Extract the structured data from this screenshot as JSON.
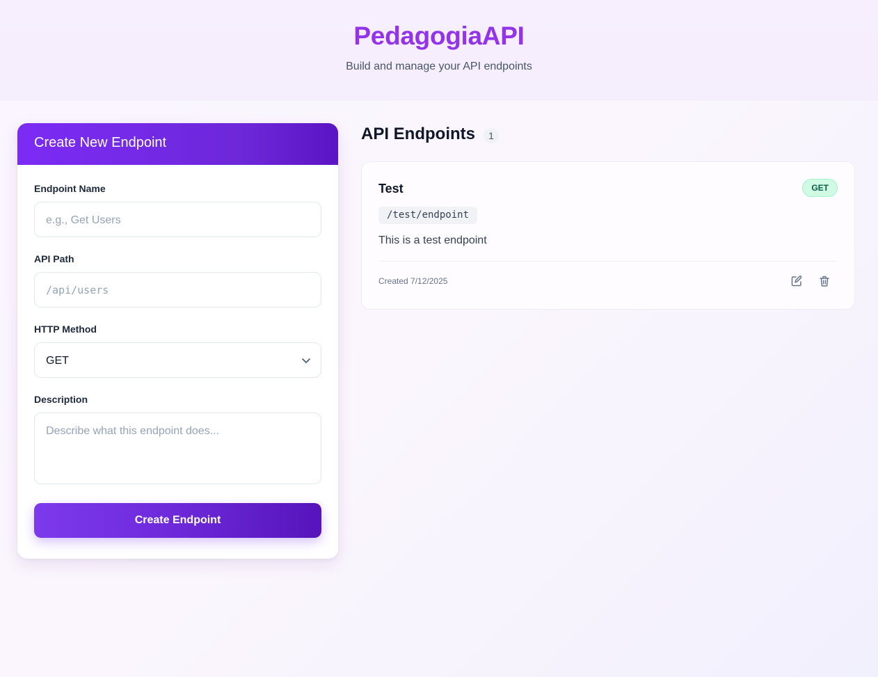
{
  "header": {
    "brand": "PedagogiaAPI",
    "tagline": "Build and manage your API endpoints"
  },
  "form": {
    "title": "Create New Endpoint",
    "name_label": "Endpoint Name",
    "name_placeholder": "e.g., Get Users",
    "path_label": "API Path",
    "path_placeholder": "/api/users",
    "method_label": "HTTP Method",
    "method_value": "GET",
    "description_label": "Description",
    "description_placeholder": "Describe what this endpoint does...",
    "submit_label": "Create Endpoint"
  },
  "list": {
    "title": "API Endpoints",
    "count": "1",
    "endpoints": [
      {
        "name": "Test",
        "method": "GET",
        "path": "/test/endpoint",
        "description": "This is a test endpoint",
        "created": "Created 7/12/2025"
      }
    ]
  },
  "icons": {
    "edit": "edit-icon",
    "delete": "trash-icon",
    "select": "chevron-down-icon"
  },
  "colors": {
    "brand": "#9333ea",
    "accent": "#6d28d9",
    "method_get_bg": "#d1fae5",
    "method_get_text": "#065f46"
  }
}
